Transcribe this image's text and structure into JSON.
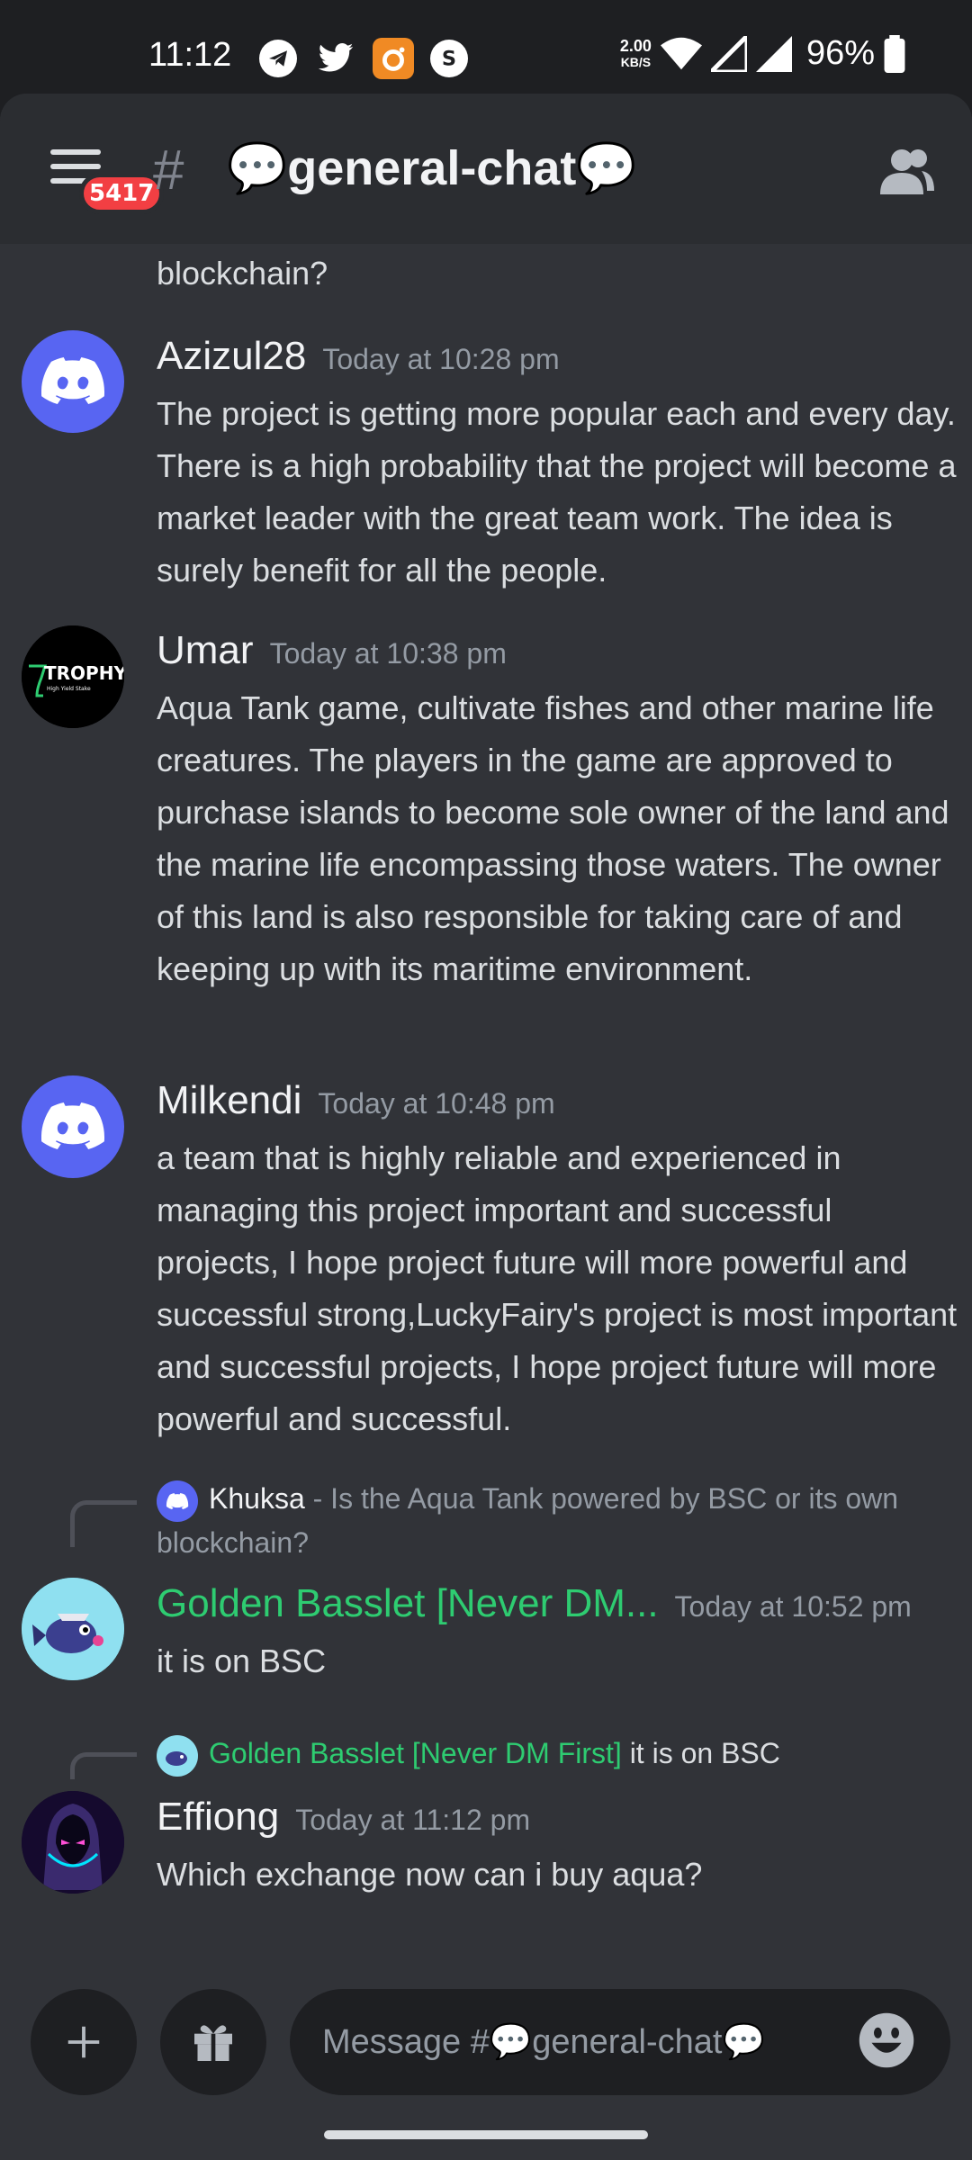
{
  "status_bar": {
    "time": "11:12",
    "net_speed_value": "2.00",
    "net_speed_unit": "KB/S",
    "battery": "96%"
  },
  "header": {
    "notification_badge": "5417",
    "channel_name": "💬general-chat💬"
  },
  "messages": {
    "top_fragment": "blockchain?",
    "m1": {
      "author": "Azizul28",
      "timestamp": "Today at 10:28 pm",
      "text": "The project is getting more popular each and every day. There is a high probability that the project will become a market leader with the great team work. The idea is surely benefit for all the people."
    },
    "m2": {
      "author": "Umar",
      "avatar_text": "TROPHY",
      "avatar_subtext": "High Yield Stake",
      "timestamp": "Today at 10:38 pm",
      "text": "Aqua Tank game, cultivate fishes and other marine life creatures. The players in the game are approved to purchase islands to become sole owner of the land and the marine life encompassing those waters. The owner of this land is also responsible for taking care of and keeping up with its maritime environment."
    },
    "m3": {
      "author": "Milkendi",
      "timestamp": "Today at 10:48 pm",
      "text": "a team that is highly reliable and experienced in managing this project important and successful projects, I hope project future will more powerful and successful strong,LuckyFairy's project is most important and successful projects, I hope project future will more powerful and successful."
    },
    "m4": {
      "reply_author": "Khuksa",
      "reply_text": "- Is the Aqua Tank powered by BSC or its own blockchain?",
      "author": "Golden Basslet [Never DM...",
      "timestamp": "Today at 10:52 pm",
      "text": "it is on BSC"
    },
    "m5": {
      "reply_author": "Golden Basslet [Never DM First]",
      "reply_text": "it is on BSC",
      "author": "Effiong",
      "timestamp": "Today at 11:12 pm",
      "text": "Which exchange now can i buy aqua?"
    }
  },
  "composer": {
    "placeholder": "Message #💬general-chat💬"
  },
  "colors": {
    "background": "#313338",
    "header": "#2b2d31",
    "blurple": "#5865f2",
    "role_green": "#2ecc71",
    "badge_red": "#f23f43"
  },
  "icons": [
    "telegram-icon",
    "twitter-icon",
    "camera-app-icon",
    "s-app-icon",
    "wifi-icon",
    "signal-icon",
    "battery-icon",
    "menu-icon",
    "members-icon",
    "plus-icon",
    "gift-icon",
    "emoji-icon"
  ]
}
